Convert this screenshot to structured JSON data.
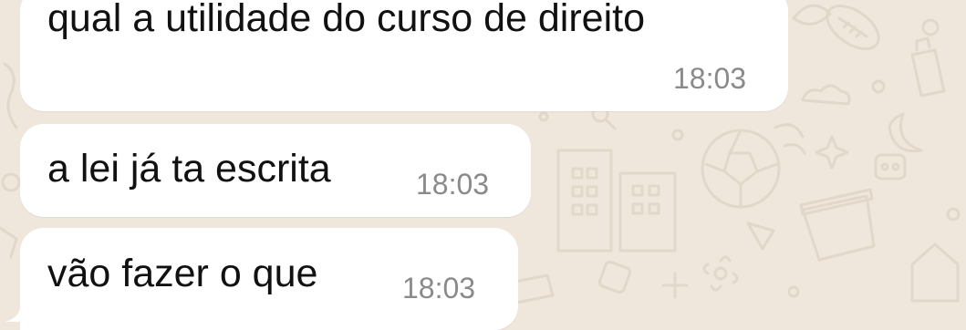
{
  "chat": {
    "messages": [
      {
        "text": "qual a utilidade do curso de direito",
        "time": "18:03"
      },
      {
        "text": "a lei já ta escrita",
        "time": "18:03"
      },
      {
        "text": "vão fazer o que",
        "time": "18:03"
      }
    ]
  },
  "colors": {
    "wallpaper": "#efe7dc",
    "bubble": "#ffffff",
    "text": "#111111",
    "time": "#8a8a8a"
  }
}
